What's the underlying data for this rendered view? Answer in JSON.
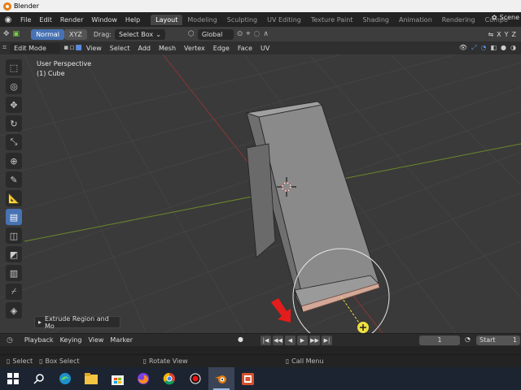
{
  "window": {
    "title": "Blender"
  },
  "menu": {
    "items": [
      "File",
      "Edit",
      "Render",
      "Window",
      "Help"
    ],
    "workspaces": [
      "Layout",
      "Modeling",
      "Sculpting",
      "UV Editing",
      "Texture Paint",
      "Shading",
      "Animation",
      "Rendering",
      "Compo"
    ],
    "active_workspace": "Layout",
    "scene_label": "Scene"
  },
  "tool_header": {
    "mode_normal": "Normal",
    "mode_xyz": "XYZ",
    "drag_label": "Drag:",
    "drag_value": "Select Box",
    "orientation": "Global",
    "axes": [
      "X",
      "Y",
      "Z"
    ]
  },
  "viewport_header": {
    "mode": "Edit Mode",
    "items": [
      "View",
      "Select",
      "Add",
      "Mesh",
      "Vertex",
      "Edge",
      "Face",
      "UV"
    ]
  },
  "viewport": {
    "perspective": "User Perspective",
    "object": "(1) Cube",
    "operator_panel": "Extrude Region and Mo"
  },
  "timeline": {
    "items": [
      "Playback",
      "Keying",
      "View",
      "Marker"
    ],
    "current_frame": "1",
    "start_label": "Start",
    "start_value": "1"
  },
  "statusbar": {
    "select": "Select",
    "box_select": "Box Select",
    "rotate_view": "Rotate View",
    "call_menu": "Call Menu"
  },
  "colors": {
    "accent_blue": "#4772b3",
    "grid_red_axis": "#9a3a3a",
    "grid_green_axis": "#6a8a2a",
    "annotation_arrow": "#e51c1c",
    "gizmo_yellow": "#f0e040"
  }
}
